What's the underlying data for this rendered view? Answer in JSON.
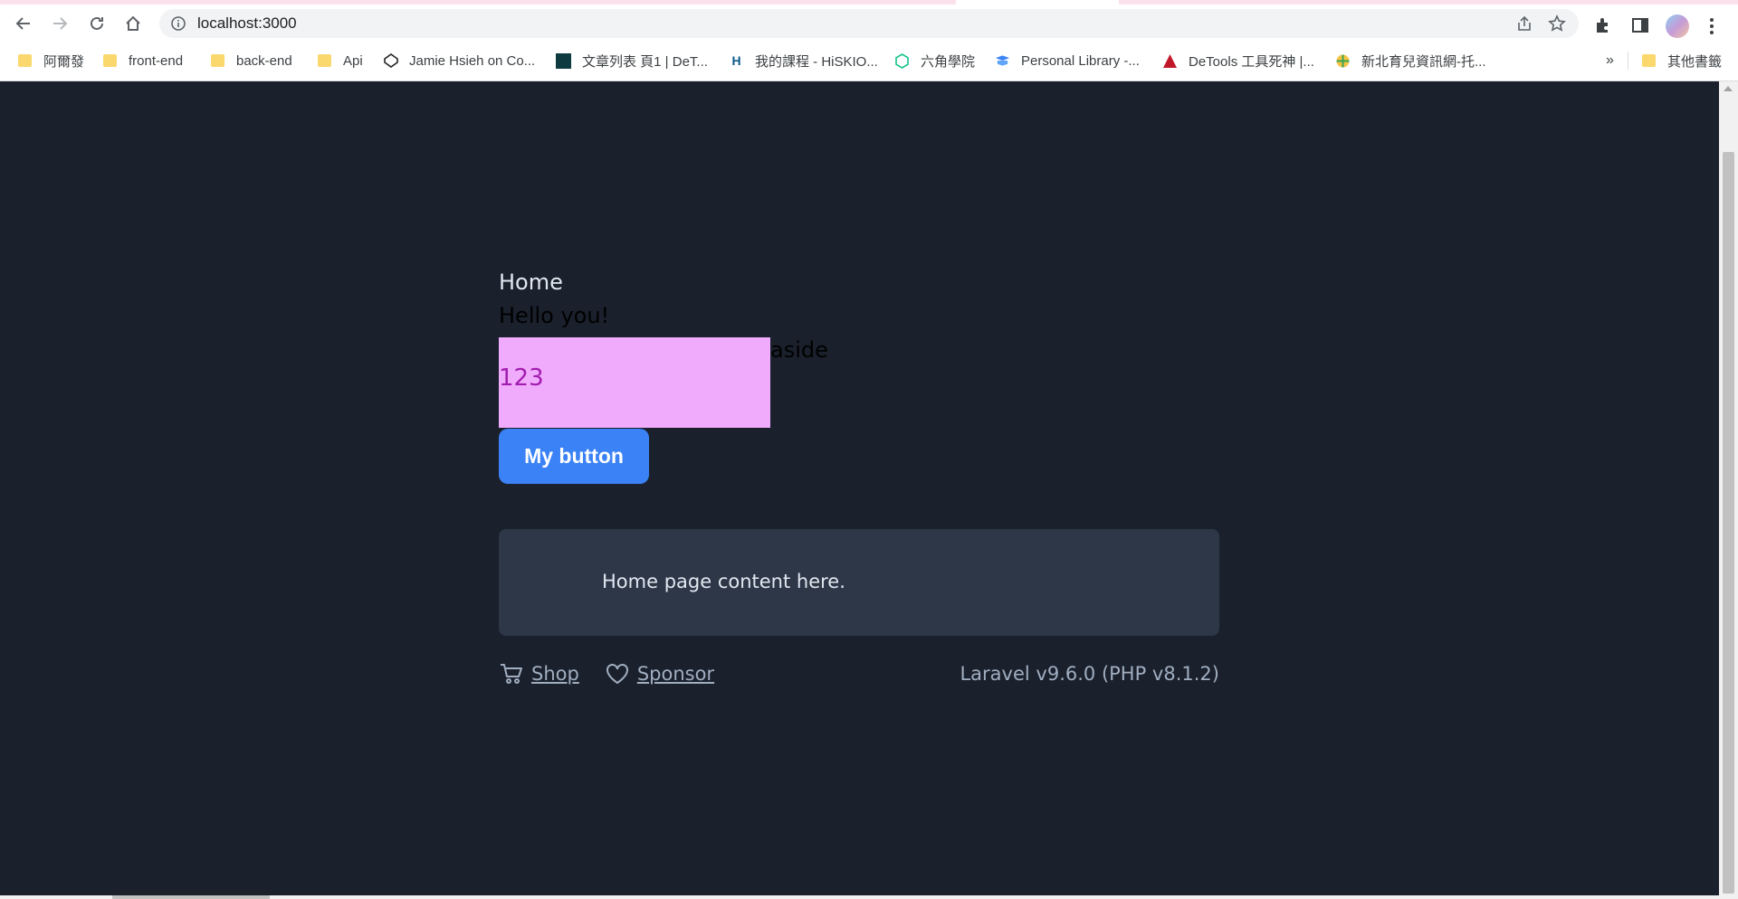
{
  "browser": {
    "url": "localhost:3000",
    "bookmarks": [
      {
        "label": "阿爾發",
        "icon": "folder-icon"
      },
      {
        "label": "front-end",
        "icon": "folder-icon"
      },
      {
        "label": "back-end",
        "icon": "folder-icon"
      },
      {
        "label": "Api",
        "icon": "folder-icon"
      },
      {
        "label": "Jamie Hsieh on Co...",
        "icon": "codepen-icon"
      },
      {
        "label": "文章列表 頁1 | DeT...",
        "icon": "site-icon"
      },
      {
        "label": "我的課程 - HiSKIO...",
        "icon": "hiskio-icon"
      },
      {
        "label": "六角學院",
        "icon": "hexschool-icon"
      },
      {
        "label": "Personal Library -...",
        "icon": "library-icon"
      },
      {
        "label": "DeTools 工具死神 |...",
        "icon": "detools-icon"
      },
      {
        "label": "新北育兒資訊網-托...",
        "icon": "globe-icon"
      }
    ],
    "other_bookmarks": "其他書籤",
    "overflow": "»"
  },
  "page": {
    "nav_home": "Home",
    "hello": "Hello you!",
    "box_text": "123",
    "aside": "aside",
    "button_label": "My button",
    "card_message": "Home page content here.",
    "footer": {
      "shop": "Shop",
      "sponsor": "Sponsor",
      "version": "Laravel v9.6.0 (PHP v8.1.2)"
    }
  },
  "colors": {
    "page_bg": "#1a202c",
    "card_bg": "#2d3748",
    "button_bg": "#3b82f6",
    "pink_box": "#f0abfc"
  }
}
